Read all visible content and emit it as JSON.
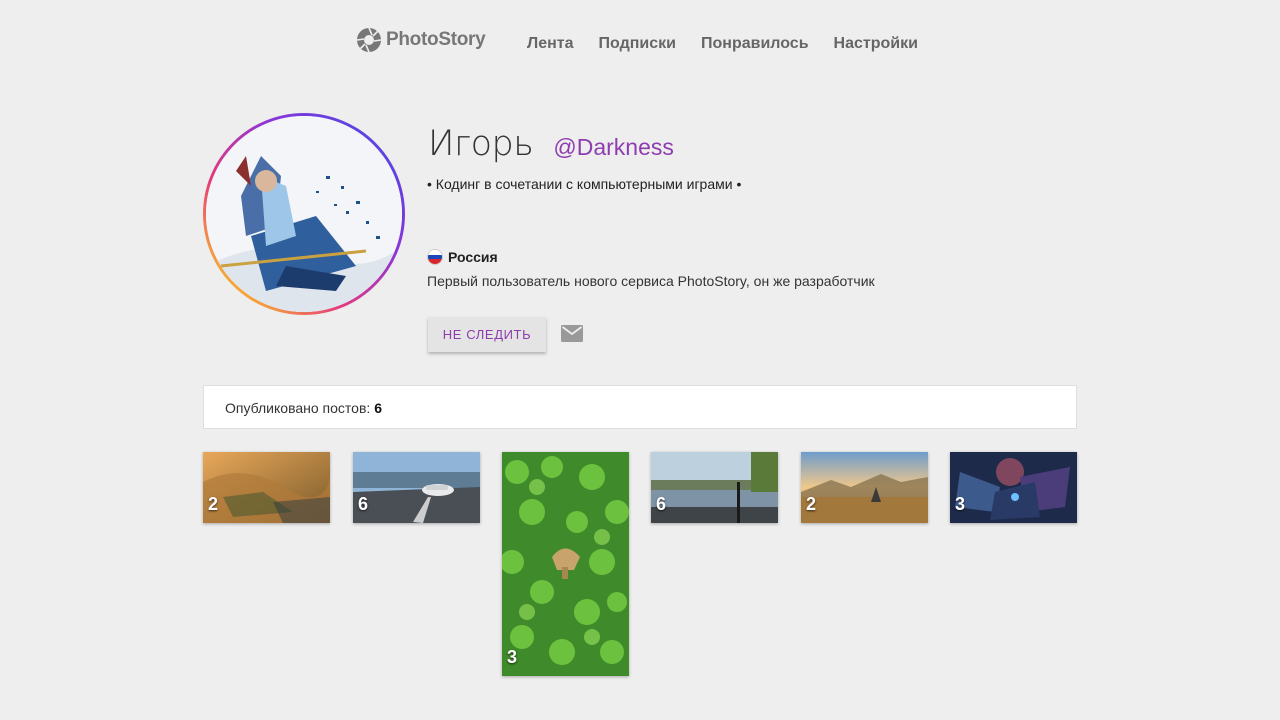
{
  "app": {
    "name": "PhotoStory"
  },
  "nav": {
    "items": [
      {
        "label": "Лента"
      },
      {
        "label": "Подписки"
      },
      {
        "label": "Понравилось"
      },
      {
        "label": "Настройки"
      }
    ]
  },
  "profile": {
    "display_name": "Игорь",
    "username": "@Darkness",
    "bio": "• Кодинг в сочетании с компьютерными играми •",
    "country": "Россия",
    "about": "Первый пользователь нового сервиса PhotoStory, он же разработчик",
    "unfollow_label": "НЕ СЛЕДИТЬ",
    "accent_color": "#8e3db0"
  },
  "posts": {
    "label": "Опубликовано постов:",
    "count": "6",
    "items": [
      {
        "count": "2",
        "icon": "desert-landscape-photo"
      },
      {
        "count": "6",
        "icon": "car-road-photo"
      },
      {
        "count": "3",
        "icon": "clover-mushroom-photo"
      },
      {
        "count": "6",
        "icon": "river-scooter-photo"
      },
      {
        "count": "2",
        "icon": "sunset-field-photo"
      },
      {
        "count": "3",
        "icon": "robot-battle-photo"
      }
    ]
  }
}
